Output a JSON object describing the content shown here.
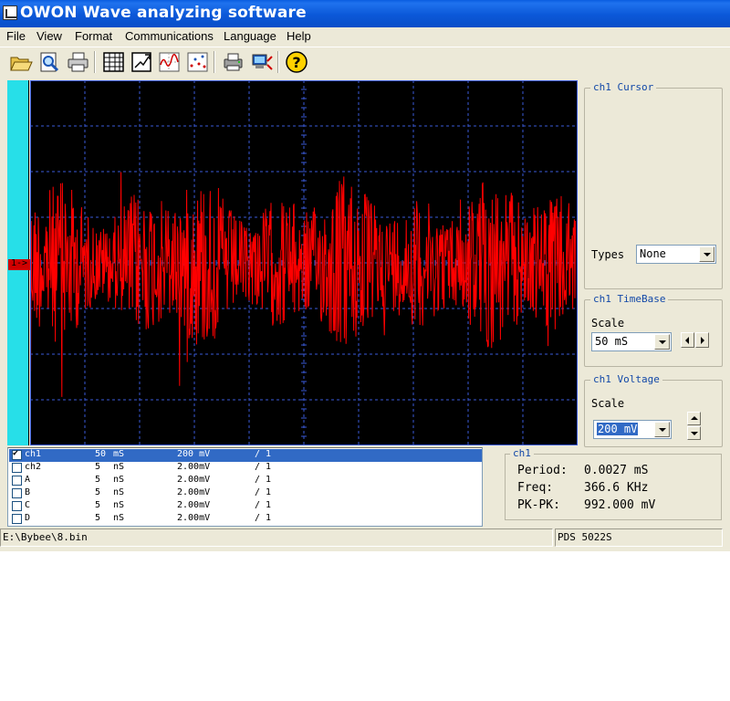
{
  "window": {
    "title": "OWON Wave analyzing software"
  },
  "menu": [
    "File",
    "View",
    "Format",
    "Communications",
    "Language",
    "Help"
  ],
  "toolbar": {
    "buttons": [
      {
        "name": "open-icon"
      },
      {
        "name": "zoom-icon"
      },
      {
        "name": "print-icon"
      },
      {
        "name": "table-icon"
      },
      {
        "name": "chart-edit-icon"
      },
      {
        "name": "waveform-icon"
      },
      {
        "name": "scatter-icon"
      },
      {
        "name": "printer-setup-icon"
      },
      {
        "name": "connect-icon"
      },
      {
        "name": "help-icon"
      }
    ]
  },
  "scope": {
    "channel_marker": "1->",
    "trace_color": "#ff0000",
    "grid_color": "#3a5ad8",
    "background": "#000000",
    "side_color": "#27dfe8"
  },
  "cursor_panel": {
    "title": "ch1 Cursor",
    "types_label": "Types",
    "types_value": "None"
  },
  "timebase_panel": {
    "title": "ch1 TimeBase",
    "scale_label": "Scale",
    "scale_value": "50 mS"
  },
  "voltage_panel": {
    "title": "ch1 Voltage",
    "scale_label": "Scale",
    "scale_value": "200 mV"
  },
  "channels": [
    {
      "name": "ch1",
      "time": "50",
      "time_unit": "mS",
      "volt": "200 mV",
      "probe": "/ 1",
      "checked": true,
      "selected": true
    },
    {
      "name": "ch2",
      "time": "5",
      "time_unit": "nS",
      "volt": "2.00mV",
      "probe": "/ 1",
      "checked": false,
      "selected": false
    },
    {
      "name": "A",
      "time": "5",
      "time_unit": "nS",
      "volt": "2.00mV",
      "probe": "/ 1",
      "checked": false,
      "selected": false
    },
    {
      "name": "B",
      "time": "5",
      "time_unit": "nS",
      "volt": "2.00mV",
      "probe": "/ 1",
      "checked": false,
      "selected": false
    },
    {
      "name": "C",
      "time": "5",
      "time_unit": "nS",
      "volt": "2.00mV",
      "probe": "/ 1",
      "checked": false,
      "selected": false
    },
    {
      "name": "D",
      "time": "5",
      "time_unit": "nS",
      "volt": "2.00mV",
      "probe": "/ 1",
      "checked": false,
      "selected": false
    }
  ],
  "measurements": {
    "title": "ch1",
    "items": [
      {
        "label": "Period:",
        "value": "0.0027 mS"
      },
      {
        "label": "Freq:",
        "value": "366.6 KHz"
      },
      {
        "label": "PK-PK:",
        "value": "992.000 mV"
      }
    ]
  },
  "status": {
    "file": "E:\\Bybee\\8.bin",
    "device": "PDS 5022S"
  }
}
